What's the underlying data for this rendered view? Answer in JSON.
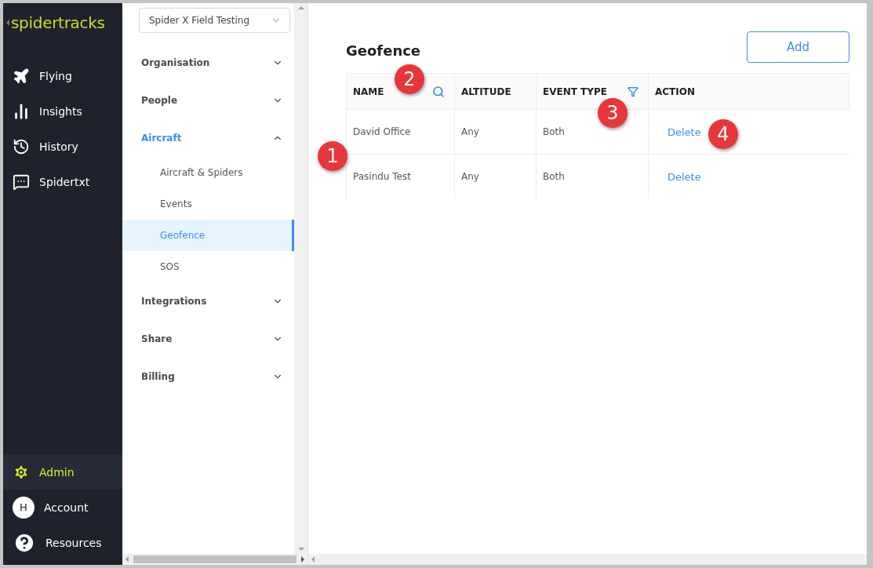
{
  "brand": {
    "logo": "spidertracks"
  },
  "nav": {
    "items": [
      {
        "label": "Flying",
        "kind": "plane",
        "selected": false
      },
      {
        "label": "Insights",
        "kind": "chart",
        "selected": false
      },
      {
        "label": "History",
        "kind": "history",
        "selected": false
      },
      {
        "label": "Spidertxt",
        "kind": "message",
        "selected": false
      }
    ],
    "bottom": [
      {
        "label": "Admin",
        "kind": "gear",
        "selected": true
      },
      {
        "label": "Account",
        "kind": "avatar",
        "initial": "H",
        "selected": false
      },
      {
        "label": "Resources",
        "kind": "help",
        "selected": false
      }
    ]
  },
  "org_select": {
    "value": "Spider X Field Testing"
  },
  "menu": [
    {
      "label": "Organisation",
      "expanded": false
    },
    {
      "label": "People",
      "expanded": false
    },
    {
      "label": "Aircraft",
      "expanded": true,
      "children": [
        {
          "label": "Aircraft & Spiders",
          "selected": false
        },
        {
          "label": "Events",
          "selected": false
        },
        {
          "label": "Geofence",
          "selected": true
        },
        {
          "label": "SOS",
          "selected": false
        }
      ]
    },
    {
      "label": "Integrations",
      "expanded": false
    },
    {
      "label": "Share",
      "expanded": false
    },
    {
      "label": "Billing",
      "expanded": false
    }
  ],
  "page": {
    "title": "Geofence",
    "add_button": "Add"
  },
  "table": {
    "columns": [
      {
        "label": "NAME",
        "kind": "search"
      },
      {
        "label": "ALTITUDE",
        "kind": "plain"
      },
      {
        "label": "EVENT TYPE",
        "kind": "filter"
      },
      {
        "label": "ACTION",
        "kind": "plain"
      }
    ],
    "rows": [
      {
        "name": "David Office",
        "altitude": "Any",
        "event_type": "Both",
        "action": "Delete"
      },
      {
        "name": "Pasindu Test",
        "altitude": "Any",
        "event_type": "Both",
        "action": "Delete"
      }
    ]
  },
  "callouts": [
    {
      "label": "1"
    },
    {
      "label": "2"
    },
    {
      "label": "3"
    },
    {
      "label": "4"
    }
  ]
}
